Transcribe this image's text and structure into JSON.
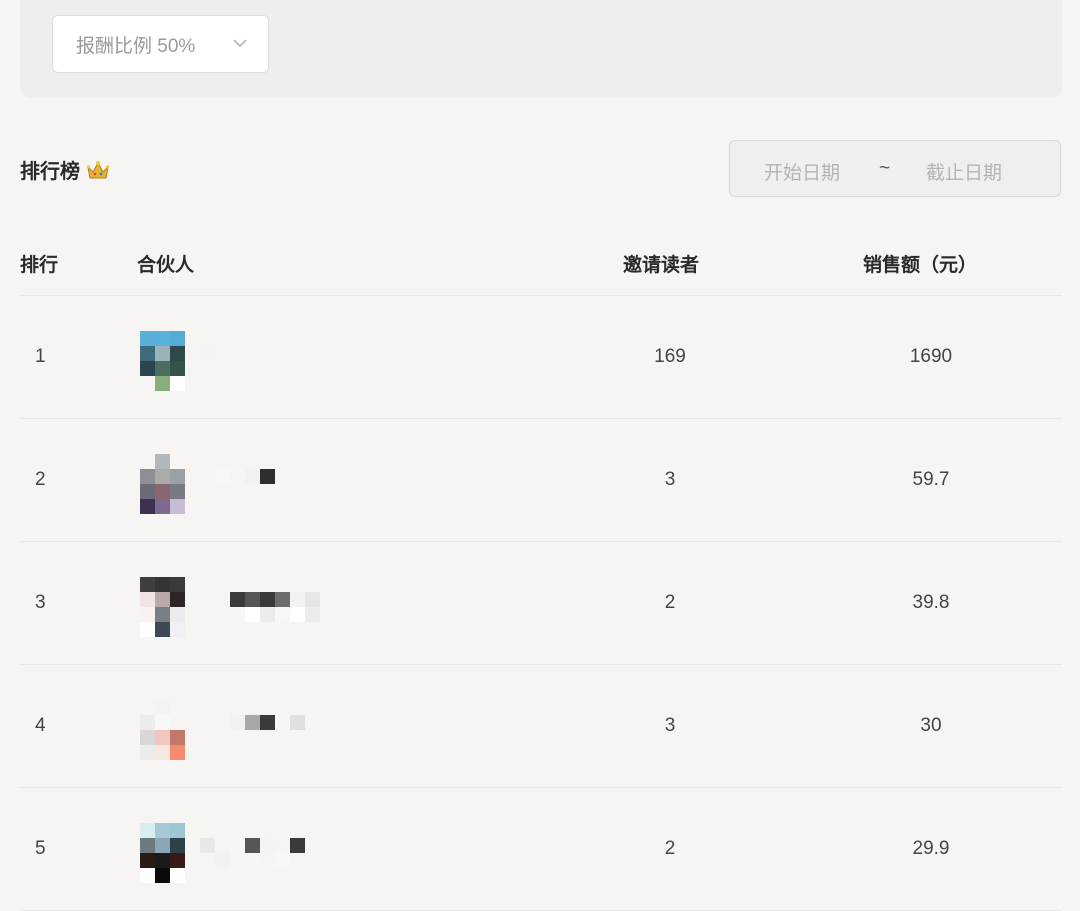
{
  "filter": {
    "ratio_select_value": "报酬比例 50%"
  },
  "leaderboard": {
    "title": "排行榜",
    "crown_icon": "crown-icon",
    "date_start_placeholder": "开始日期",
    "date_separator": "~",
    "date_end_placeholder": "截止日期"
  },
  "table": {
    "headers": {
      "rank": "排行",
      "partner": "合伙人",
      "invited": "邀请读者",
      "sales": "销售额（元）"
    },
    "rows": [
      {
        "rank": "1",
        "invited": "169",
        "sales": "1690"
      },
      {
        "rank": "2",
        "invited": "3",
        "sales": "59.7"
      },
      {
        "rank": "3",
        "invited": "2",
        "sales": "39.8"
      },
      {
        "rank": "4",
        "invited": "3",
        "sales": "30"
      },
      {
        "rank": "5",
        "invited": "2",
        "sales": "29.9"
      }
    ]
  }
}
